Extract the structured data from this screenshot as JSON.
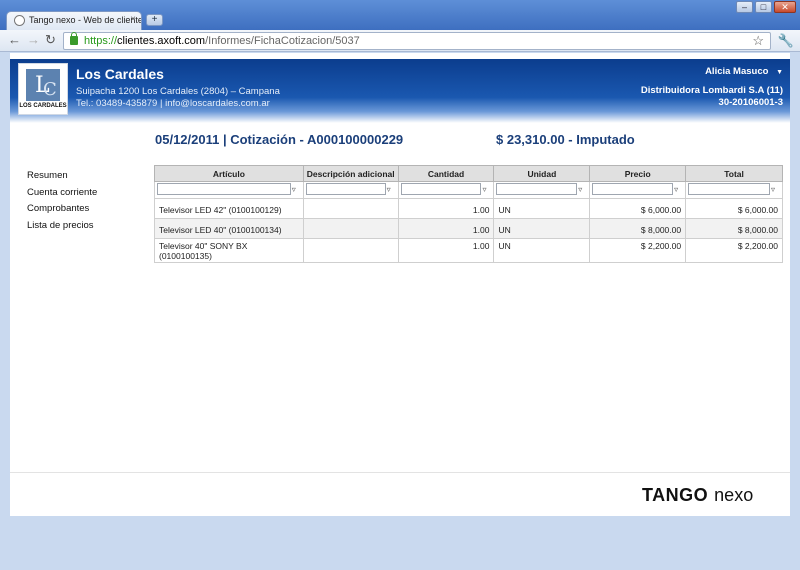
{
  "browser": {
    "tab_title": "Tango nexo - Web de clientes",
    "tab_close": "×",
    "new_tab": "+",
    "window_buttons": {
      "minimize": "–",
      "maximize": "□",
      "close": "✕"
    },
    "back": "←",
    "forward": "→",
    "reload": "↻",
    "url_scheme": "https://",
    "url_host": "clientes.axoft.com",
    "url_path": "/Informes/FichaCotizacion/5037",
    "star": "☆",
    "wrench": "🔧"
  },
  "header": {
    "logo_text": "LOS CARDALES",
    "logo_initial_l": "L",
    "logo_initial_c": "C",
    "company_name": "Los Cardales",
    "address": "Suipacha 1200 Los Cardales (2804) – Campana",
    "contact": "Tel.: 03489-435879 | info@loscardales.com.ar",
    "user_name": "Alicia Masuco",
    "user_menu": "▼",
    "distributor": "Distribuidora Lombardi S.A (11)",
    "cuit": "30-20106001-3"
  },
  "document": {
    "title": "05/12/2011 | Cotización - A000100000229",
    "total": "$ 23,310.00 - Imputado"
  },
  "sidebar": {
    "items": [
      {
        "label": "Resumen"
      },
      {
        "label": "Cuenta corriente"
      },
      {
        "label": "Comprobantes"
      },
      {
        "label": "Lista de precios"
      }
    ]
  },
  "table": {
    "columns": [
      "Artículo",
      "Descripción adicional",
      "Cantidad",
      "Unidad",
      "Precio",
      "Total"
    ],
    "filter_icon": "▿",
    "rows": [
      {
        "articulo": "Televisor LED 42\" (0100100129)",
        "descripcion": "",
        "cantidad": "1.00",
        "unidad": "UN",
        "precio": "$ 6,000.00",
        "total": "$ 6,000.00"
      },
      {
        "articulo": "Televisor LED 40\" (0100100134)",
        "descripcion": "",
        "cantidad": "1.00",
        "unidad": "UN",
        "precio": "$ 8,000.00",
        "total": "$ 8,000.00"
      },
      {
        "articulo": "Televisor 40\" SONY BX (0100100135)",
        "descripcion": "",
        "cantidad": "1.00",
        "unidad": "UN",
        "precio": "$ 2,200.00",
        "total": "$ 2,200.00"
      }
    ]
  },
  "footer": {
    "brand_tango": "TANGO",
    "brand_nexo": "nexo"
  }
}
